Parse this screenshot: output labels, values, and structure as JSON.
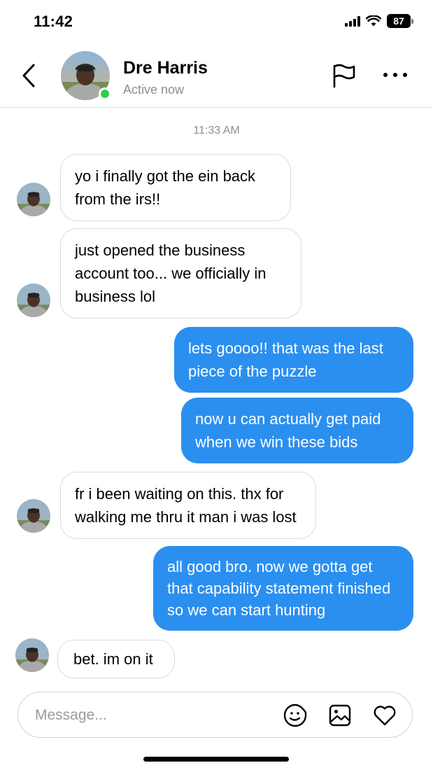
{
  "status_bar": {
    "time": "11:42",
    "battery": "87"
  },
  "header": {
    "contact_name": "Dre Harris",
    "contact_status": "Active now",
    "icons": [
      "back-chevron",
      "flag",
      "more-horizontal"
    ]
  },
  "conversation": {
    "timestamp": "11:33 AM",
    "messages": [
      {
        "direction": "in",
        "lines": [
          "yo i finally got the ein back",
          "from the irs!!"
        ]
      },
      {
        "direction": "in",
        "lines": [
          "just opened the business",
          "account too... we officially in",
          "business lol"
        ]
      },
      {
        "direction": "out",
        "lines": [
          "lets goooo!! that was the last",
          "piece of the puzzle"
        ]
      },
      {
        "direction": "out",
        "lines": [
          "now u can actually get paid",
          "when we win these bids"
        ]
      },
      {
        "direction": "in",
        "lines": [
          "fr i been waiting on this. thx for",
          "walking me thru it man i was lost"
        ]
      },
      {
        "direction": "out",
        "lines": [
          "all good bro. now we gotta get",
          "that capability statement finished",
          "so we can start hunting"
        ]
      },
      {
        "direction": "in",
        "lines": [
          "bet. im on it"
        ]
      }
    ]
  },
  "composer": {
    "placeholder": "Message...",
    "icons": [
      "sticker-smile",
      "image",
      "heart"
    ]
  },
  "colors": {
    "outgoing_bubble": "#2b8ff0",
    "online_dot": "#2ecf4f",
    "muted_text": "#8e8e8e"
  }
}
